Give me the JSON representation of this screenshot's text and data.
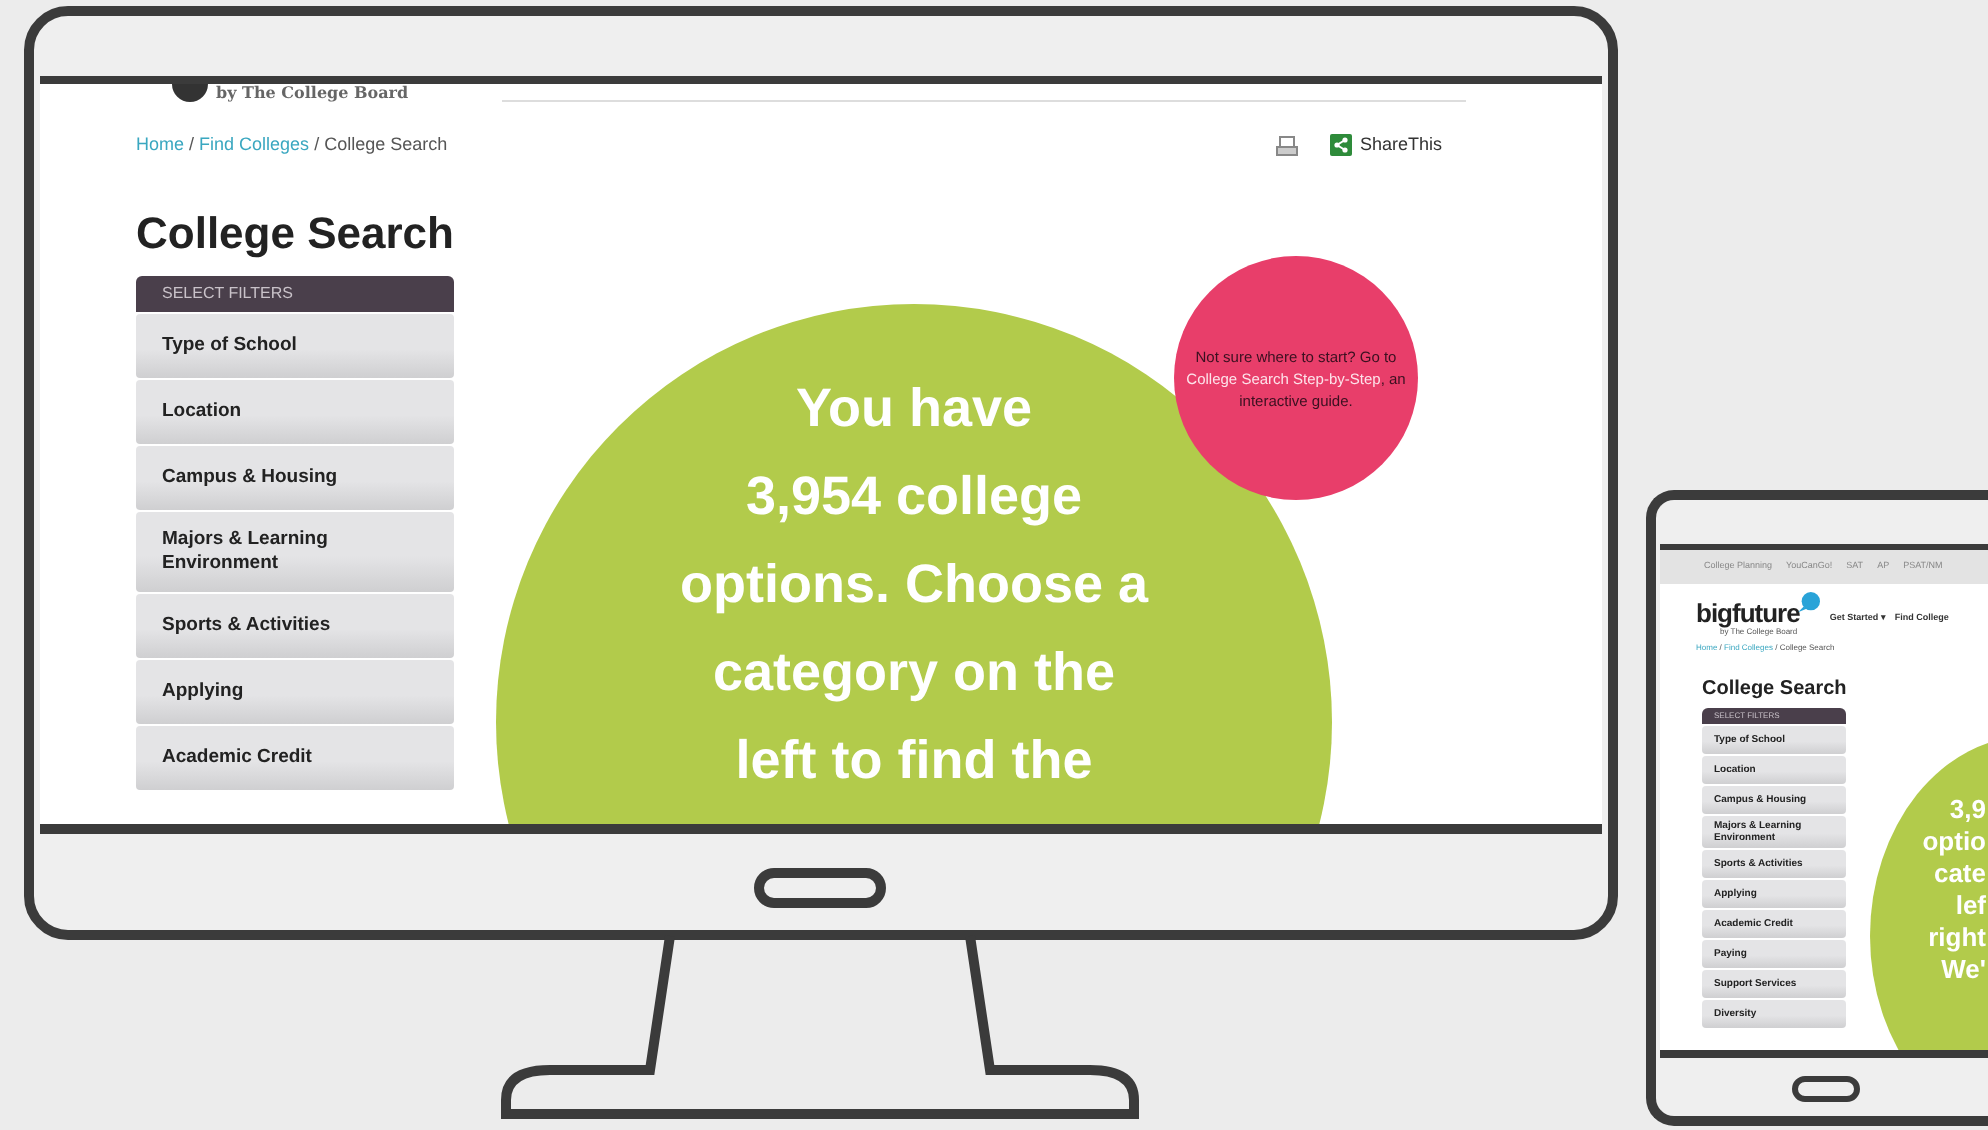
{
  "monitor": {
    "logo_tagline": "by The College Board",
    "breadcrumb": [
      {
        "label": "Home",
        "link": true
      },
      {
        "label": "Find Colleges",
        "link": true
      },
      {
        "label": "College Search",
        "link": false
      }
    ],
    "separator": "/",
    "share_label": "ShareThis",
    "heading": "College Search",
    "filter_header": "SELECT FILTERS",
    "filters": [
      "Type of School",
      "Location",
      "Campus & Housing",
      "Majors & Learning Environment",
      "Sports & Activities",
      "Applying",
      "Academic Credit"
    ],
    "headline_lines": [
      "You have",
      "3,954 college",
      "options. Choose a",
      "category on the",
      "left to find the"
    ],
    "tip": {
      "before": "Not sure where to start? Go to",
      "link": "College Search Step-by-Step",
      "after": ", an interactive guide."
    }
  },
  "tablet": {
    "top_nav": [
      "College Planning",
      "YouCanGo!",
      "SAT",
      "AP",
      "PSAT/NM"
    ],
    "logo": "bigfuture",
    "logo_tagline": "by The College Board",
    "nav": [
      "Get Started ▾",
      "Find College"
    ],
    "breadcrumb": [
      {
        "label": "Home",
        "link": true
      },
      {
        "label": "Find Colleges",
        "link": true
      },
      {
        "label": "College Search",
        "link": false
      }
    ],
    "separator": "/",
    "heading": "College Search",
    "filter_header": "SELECT FILTERS",
    "filters": [
      "Type of School",
      "Location",
      "Campus & Housing",
      "Majors & Learning Environment",
      "Sports & Activities",
      "Applying",
      "Academic Credit",
      "Paying",
      "Support Services",
      "Diversity"
    ],
    "headline_lines": [
      "3,9",
      "optio",
      "cate",
      "lef",
      "right",
      "We'"
    ]
  }
}
